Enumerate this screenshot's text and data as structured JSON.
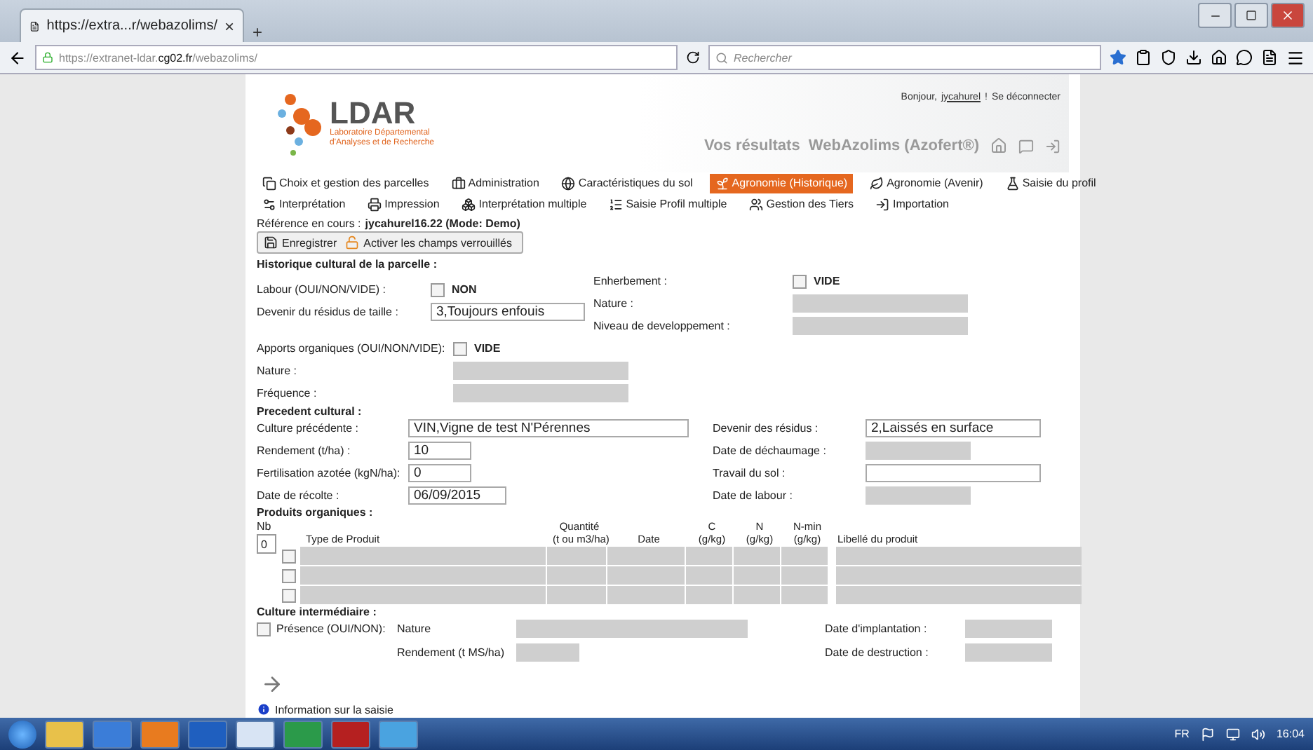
{
  "browser": {
    "tab_title": "https://extra...r/webazolims/",
    "tab_close": "×",
    "new_tab": "+",
    "url_prefix": "https://extranet-ldar.",
    "url_domain": "cg02.fr",
    "url_path": "/webazolims/",
    "search_placeholder": "Rechercher"
  },
  "header": {
    "logo": "LDAR",
    "logo_subtitle": "Laboratoire Départemental d'Analyses et de Recherche",
    "greeting": "Bonjour,",
    "user": "jycahurel",
    "separator": "!",
    "logout": "Se déconnecter",
    "title": "Vos résultats  WebAzolims (Azofert®)"
  },
  "menu": [
    [
      {
        "label": "Choix et gestion des parcelles",
        "selected": false
      },
      {
        "label": "Administration",
        "selected": false
      },
      {
        "label": "Caractéristiques du sol",
        "selected": false
      },
      {
        "label": "Agronomie (Historique)",
        "selected": true
      },
      {
        "label": "Agronomie (Avenir)",
        "selected": false
      },
      {
        "label": "Saisie du profil",
        "selected": false
      }
    ],
    [
      {
        "label": "Interprétation",
        "selected": false
      },
      {
        "label": "Impression",
        "selected": false
      },
      {
        "label": "Interprétation multiple",
        "selected": false
      },
      {
        "label": "Saisie Profil multiple",
        "selected": false
      },
      {
        "label": "Gestion des Tiers",
        "selected": false
      },
      {
        "label": "Importation",
        "selected": false
      }
    ]
  ],
  "reference": {
    "label": "Référence en cours :",
    "value": "jycahurel16.22 (Mode: Demo)"
  },
  "actions": [
    "Enregistrer",
    "Activer les champs verrouillés"
  ],
  "historique": {
    "title": "Historique cultural de la parcelle :",
    "left": [
      {
        "kind": "checkbox",
        "label": "Labour (OUI/NON/VIDE) :",
        "checked": false,
        "text": "NON"
      },
      {
        "kind": "field",
        "label": "Devenir du résidus de taille :",
        "value": "3,Toujours enfouis",
        "disabled": false
      }
    ],
    "right": [
      {
        "kind": "checkbox",
        "label": "Enherbement :",
        "checked": false,
        "text": "VIDE"
      },
      {
        "kind": "field",
        "label": "Nature :",
        "disabled": true
      },
      {
        "kind": "field",
        "label": "Niveau de developpement :",
        "disabled": true
      }
    ],
    "apports": [
      {
        "kind": "checkbox",
        "label": "Apports organiques (OUI/NON/VIDE):",
        "checked": false,
        "text": "VIDE"
      },
      {
        "kind": "field",
        "label": "Nature :",
        "disabled": true
      },
      {
        "kind": "field",
        "label": "Fréquence :",
        "disabled": true
      }
    ]
  },
  "precedent": {
    "title": "Precedent cultural :",
    "left": [
      {
        "kind": "field",
        "label": "Culture précédente :",
        "value": "VIN,Vigne de test N'Pérennes",
        "disabled": false
      },
      {
        "kind": "field",
        "label": "Rendement (t/ha) :",
        "value": "10",
        "disabled": false
      },
      {
        "kind": "field",
        "label": "Fertilisation azotée (kgN/ha):",
        "value": "0",
        "disabled": false
      },
      {
        "kind": "field",
        "label": "Date de récolte :",
        "value": "06/09/2015",
        "disabled": false
      }
    ],
    "right": [
      {
        "kind": "field",
        "label": "Devenir des résidus :",
        "value": "2,Laissés en surface",
        "disabled": false
      },
      {
        "kind": "field",
        "label": "Date de déchaumage :",
        "disabled": true
      },
      {
        "kind": "field",
        "label": "Travail du sol :",
        "disabled": false
      },
      {
        "kind": "field",
        "label": "Date de labour :",
        "disabled": true
      }
    ]
  },
  "produits": {
    "title": "Produits organiques :",
    "nb_label": "Nb",
    "nb_value": "0",
    "columns": [
      "Type de Produit",
      "Quantité\n(t ou m3/ha)",
      "Date",
      "C\n(g/kg)",
      "N\n(g/kg)",
      "N-min\n(g/kg)",
      "Libellé du produit"
    ],
    "rows": [
      {
        "checked": false
      },
      {
        "checked": false
      },
      {
        "checked": false
      }
    ]
  },
  "intermediaire": {
    "title": "Culture intermédiaire :",
    "presence": {
      "label": "Présence (OUI/NON):",
      "checked": false
    },
    "fields": [
      {
        "label": "Nature",
        "disabled": true
      },
      {
        "label": "Date d'implantation :",
        "disabled": true
      },
      {
        "label": "Rendement (t MS/ha)",
        "disabled": true
      },
      {
        "label": "Date de destruction :",
        "disabled": true
      }
    ]
  },
  "info": "Information sur la saisie",
  "taskbar": {
    "language": "FR",
    "time": "16:04"
  }
}
